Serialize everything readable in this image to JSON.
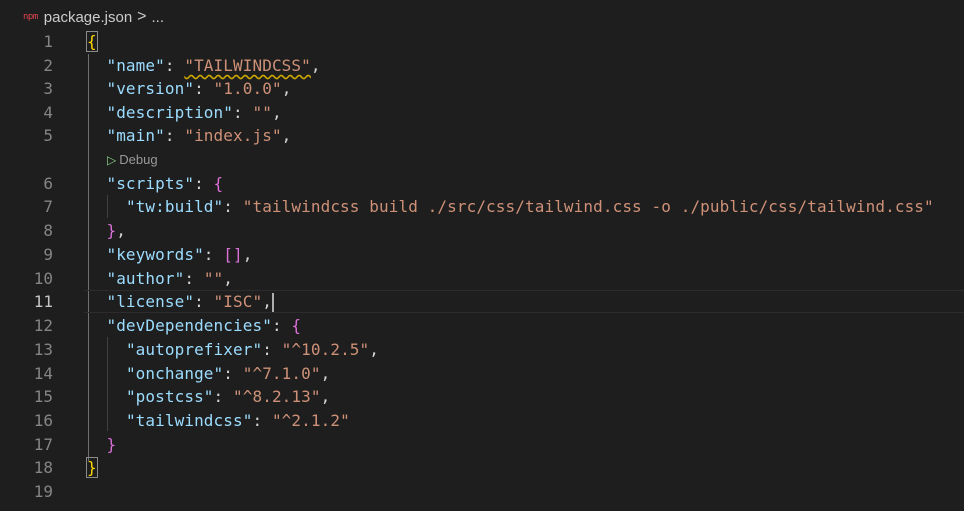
{
  "breadcrumb": {
    "file_icon_text": "npm",
    "file_name": "package.json",
    "separator": ">",
    "more": "..."
  },
  "codelens": {
    "icon": "play-triangle-icon",
    "label": "Debug"
  },
  "lines": [
    {
      "n": "1",
      "tokens": [
        {
          "t": "{",
          "c": "b1 bm"
        }
      ]
    },
    {
      "n": "2",
      "tokens": [
        {
          "t": "  "
        },
        {
          "t": "\"name\"",
          "c": "k"
        },
        {
          "t": ": ",
          "c": "p"
        },
        {
          "t": "\"TAILWINDCSS\"",
          "c": "s squig"
        },
        {
          "t": ",",
          "c": "p"
        }
      ]
    },
    {
      "n": "3",
      "tokens": [
        {
          "t": "  "
        },
        {
          "t": "\"version\"",
          "c": "k"
        },
        {
          "t": ": ",
          "c": "p"
        },
        {
          "t": "\"1.0.0\"",
          "c": "s"
        },
        {
          "t": ",",
          "c": "p"
        }
      ]
    },
    {
      "n": "4",
      "tokens": [
        {
          "t": "  "
        },
        {
          "t": "\"description\"",
          "c": "k"
        },
        {
          "t": ": ",
          "c": "p"
        },
        {
          "t": "\"\"",
          "c": "s"
        },
        {
          "t": ",",
          "c": "p"
        }
      ]
    },
    {
      "n": "5",
      "tokens": [
        {
          "t": "  "
        },
        {
          "t": "\"main\"",
          "c": "k"
        },
        {
          "t": ": ",
          "c": "p"
        },
        {
          "t": "\"index.js\"",
          "c": "s"
        },
        {
          "t": ",",
          "c": "p"
        }
      ]
    },
    {
      "n": "6",
      "tokens": [
        {
          "t": "  "
        },
        {
          "t": "\"scripts\"",
          "c": "k"
        },
        {
          "t": ": ",
          "c": "p"
        },
        {
          "t": "{",
          "c": "b2"
        }
      ]
    },
    {
      "n": "7",
      "tokens": [
        {
          "t": "    "
        },
        {
          "t": "\"tw:build\"",
          "c": "k"
        },
        {
          "t": ": ",
          "c": "p"
        },
        {
          "t": "\"tailwindcss build ./src/css/tailwind.css -o ./public/css/tailwind.css\"",
          "c": "s"
        }
      ]
    },
    {
      "n": "8",
      "tokens": [
        {
          "t": "  "
        },
        {
          "t": "}",
          "c": "b2"
        },
        {
          "t": ",",
          "c": "p"
        }
      ]
    },
    {
      "n": "9",
      "tokens": [
        {
          "t": "  "
        },
        {
          "t": "\"keywords\"",
          "c": "k"
        },
        {
          "t": ": ",
          "c": "p"
        },
        {
          "t": "[]",
          "c": "b2"
        },
        {
          "t": ",",
          "c": "p"
        }
      ]
    },
    {
      "n": "10",
      "tokens": [
        {
          "t": "  "
        },
        {
          "t": "\"author\"",
          "c": "k"
        },
        {
          "t": ": ",
          "c": "p"
        },
        {
          "t": "\"\"",
          "c": "s"
        },
        {
          "t": ",",
          "c": "p"
        }
      ]
    },
    {
      "n": "11",
      "tokens": [
        {
          "t": "  "
        },
        {
          "t": "\"license\"",
          "c": "k"
        },
        {
          "t": ": ",
          "c": "p"
        },
        {
          "t": "\"ISC\"",
          "c": "s"
        },
        {
          "t": ",",
          "c": "p"
        }
      ],
      "current": true
    },
    {
      "n": "12",
      "tokens": [
        {
          "t": "  "
        },
        {
          "t": "\"devDependencies\"",
          "c": "k"
        },
        {
          "t": ": ",
          "c": "p"
        },
        {
          "t": "{",
          "c": "b2"
        }
      ]
    },
    {
      "n": "13",
      "tokens": [
        {
          "t": "    "
        },
        {
          "t": "\"autoprefixer\"",
          "c": "k"
        },
        {
          "t": ": ",
          "c": "p"
        },
        {
          "t": "\"^10.2.5\"",
          "c": "s"
        },
        {
          "t": ",",
          "c": "p"
        }
      ]
    },
    {
      "n": "14",
      "tokens": [
        {
          "t": "    "
        },
        {
          "t": "\"onchange\"",
          "c": "k"
        },
        {
          "t": ": ",
          "c": "p"
        },
        {
          "t": "\"^7.1.0\"",
          "c": "s"
        },
        {
          "t": ",",
          "c": "p"
        }
      ]
    },
    {
      "n": "15",
      "tokens": [
        {
          "t": "    "
        },
        {
          "t": "\"postcss\"",
          "c": "k"
        },
        {
          "t": ": ",
          "c": "p"
        },
        {
          "t": "\"^8.2.13\"",
          "c": "s"
        },
        {
          "t": ",",
          "c": "p"
        }
      ]
    },
    {
      "n": "16",
      "tokens": [
        {
          "t": "    "
        },
        {
          "t": "\"tailwindcss\"",
          "c": "k"
        },
        {
          "t": ": ",
          "c": "p"
        },
        {
          "t": "\"^2.1.2\"",
          "c": "s"
        }
      ]
    },
    {
      "n": "17",
      "tokens": [
        {
          "t": "  "
        },
        {
          "t": "}",
          "c": "b2"
        }
      ]
    },
    {
      "n": "18",
      "tokens": [
        {
          "t": "}",
          "c": "b1 bm"
        }
      ]
    },
    {
      "n": "19",
      "tokens": []
    }
  ],
  "colors": {
    "background": "#1e1e1e",
    "key": "#9cdcfe",
    "string": "#ce9178",
    "bracket_outer": "#ffd700",
    "bracket_inner": "#da70d6",
    "file_icon": "#e0444f"
  }
}
